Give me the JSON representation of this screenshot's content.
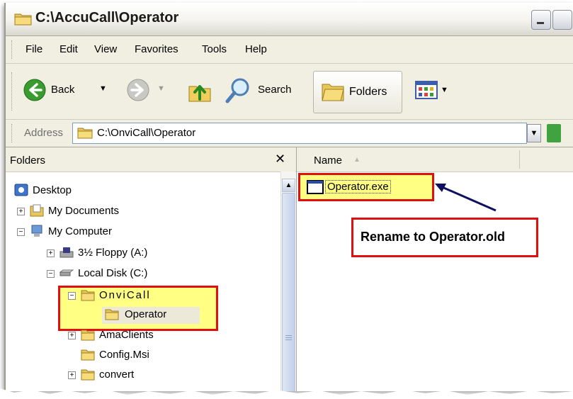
{
  "window": {
    "title": "C:\\AccuCall\\Operator"
  },
  "menu": {
    "items": [
      "File",
      "Edit",
      "View",
      "Favorites",
      "Tools",
      "Help"
    ]
  },
  "toolbar": {
    "back_label": "Back",
    "search_label": "Search",
    "folders_label": "Folders"
  },
  "address": {
    "label": "Address",
    "value": "C:\\OnviCall\\Operator"
  },
  "folders_pane": {
    "title": "Folders",
    "close_glyph": "✕",
    "tree": [
      {
        "label": "Desktop",
        "icon": "desktop-icon"
      },
      {
        "label": "My Documents",
        "icon": "my-documents-icon"
      },
      {
        "label": "My Computer",
        "icon": "my-computer-icon"
      },
      {
        "label": "3½ Floppy (A:)",
        "icon": "floppy-drive-icon"
      },
      {
        "label": "Local Disk (C:)",
        "icon": "hard-disk-icon"
      },
      {
        "label": "OnviCall",
        "icon": "folder-icon"
      },
      {
        "label": "Operator",
        "icon": "folder-icon"
      },
      {
        "label": "AmaClients",
        "icon": "folder-icon"
      },
      {
        "label": "Config.Msi",
        "icon": "folder-icon"
      },
      {
        "label": "convert",
        "icon": "folder-icon"
      }
    ]
  },
  "files_pane": {
    "column_name": "Name",
    "files": [
      {
        "label": "Operator.exe",
        "icon": "application-icon"
      }
    ]
  },
  "annotation": {
    "callout_text": "Rename to Operator.old",
    "highlight_color": "#ffff5a",
    "border_color": "#e01010",
    "arrow_color": "#101060"
  }
}
